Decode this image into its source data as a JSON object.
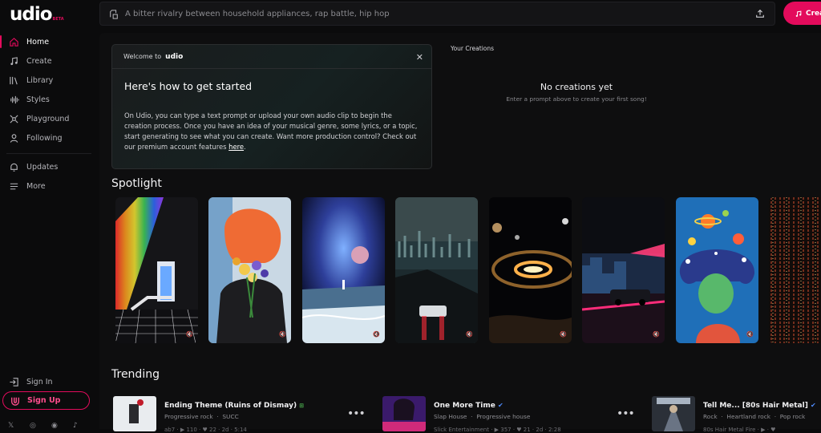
{
  "app": {
    "logo": "udio",
    "beta": "BETA"
  },
  "sidebar": {
    "items": [
      {
        "label": "Home",
        "icon": "home-icon",
        "active": true
      },
      {
        "label": "Create",
        "icon": "music-note-icon"
      },
      {
        "label": "Library",
        "icon": "library-icon"
      },
      {
        "label": "Styles",
        "icon": "waveform-icon"
      },
      {
        "label": "Playground",
        "icon": "playground-icon"
      },
      {
        "label": "Following",
        "icon": "user-icon"
      }
    ],
    "secondary": [
      {
        "label": "Updates",
        "icon": "bell-icon"
      },
      {
        "label": "More",
        "icon": "menu-icon"
      }
    ],
    "sign_in": "Sign In",
    "sign_up": "Sign Up",
    "social_icons": [
      "x-icon",
      "instagram-icon",
      "discord-icon",
      "tiktok-icon"
    ]
  },
  "search": {
    "placeholder": "A bitter rivalry between household appliances, rap battle, hip hop"
  },
  "header": {
    "create_label": "Crea"
  },
  "welcome": {
    "label": "Welcome to",
    "logo": "udio",
    "title": "Here's how to get started",
    "body": "On Udio, you can type a text prompt or upload your own audio clip to begin the creation process. Once you have an idea of your musical genre, some lyrics, or a topic, start generating to see what you can create. Want more production control? Check out our premium account features ",
    "link": "here",
    "period": "."
  },
  "creations": {
    "title": "Your Creations",
    "empty_title": "No creations yet",
    "empty_sub": "Enter a prompt above to create your first song!"
  },
  "spotlight": {
    "title": "Spotlight"
  },
  "trending": {
    "title": "Trending",
    "items": [
      {
        "title": "Ending Theme (Ruins of Dismay)",
        "genre1": "Progressive rock",
        "genre2": "SUCC",
        "stats": "ab7 · ▶ 110 · ♥ 22 · 2d · 5:14"
      },
      {
        "title": "One More Time",
        "genre1": "Slap House",
        "genre2": "Progressive house",
        "stats": "Slick Entertainment · ▶ 357 · ♥ 21 · 2d · 2:28"
      },
      {
        "title": "Tell Me... [80s Hair Metal]",
        "genre1": "Rock",
        "genre2": "Heartland rock",
        "genre3": "Pop rock",
        "stats": "80s Hair Metal Fire · ▶ · ♥"
      }
    ]
  },
  "colors": {
    "accent": "#e30b5c",
    "background": "#0b0b0c",
    "panel": "#0e0e0f"
  }
}
